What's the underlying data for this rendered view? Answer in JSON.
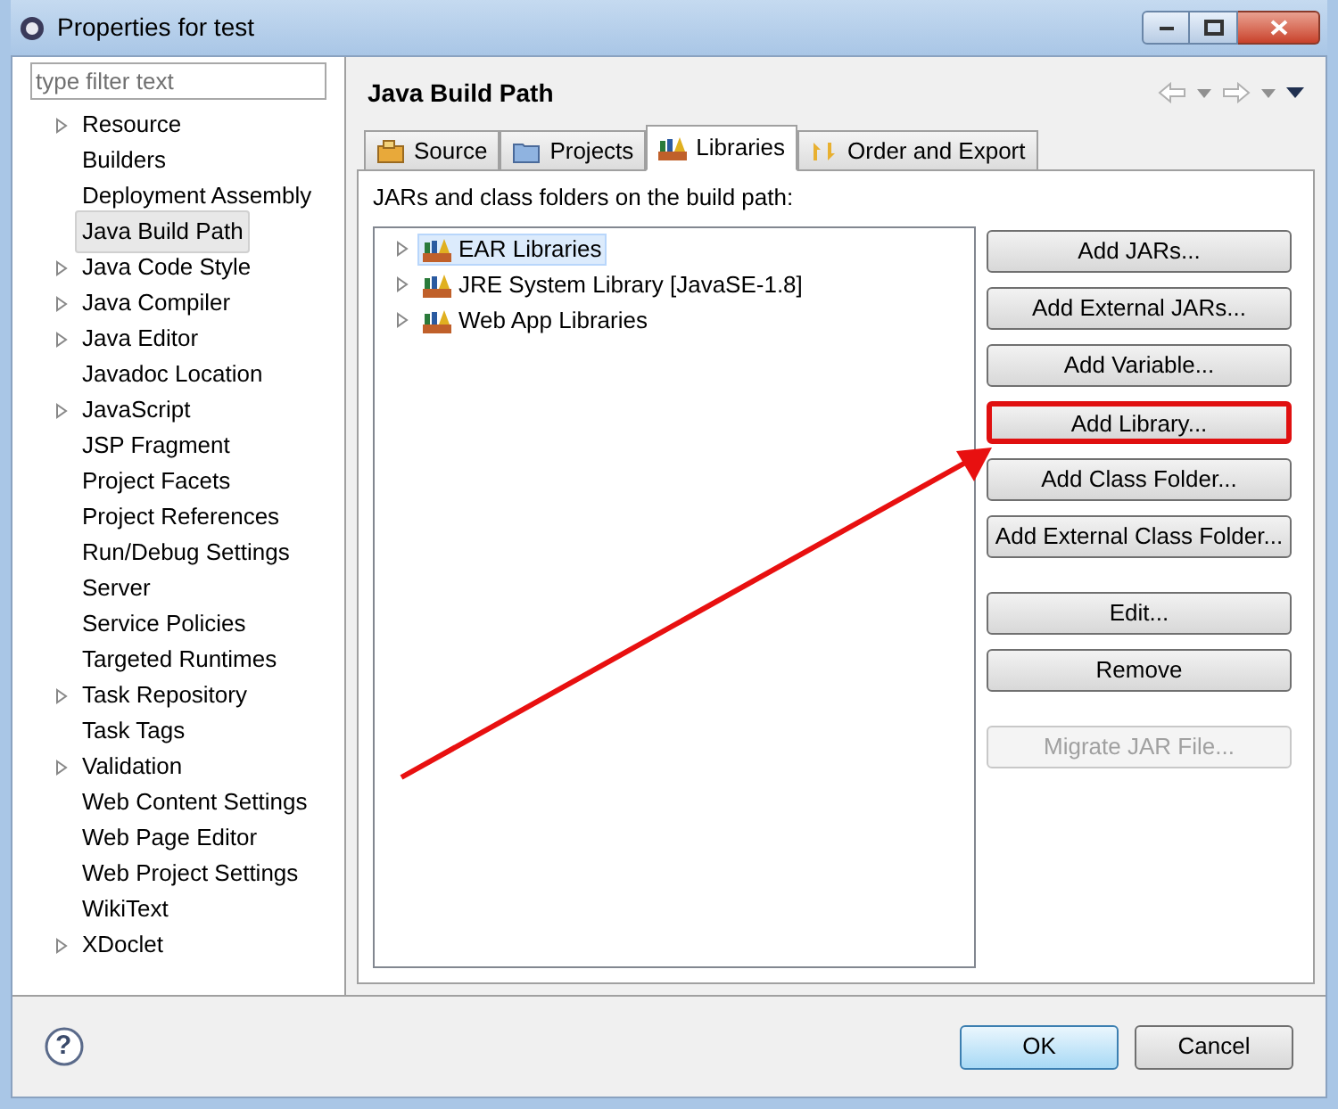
{
  "window": {
    "title": "Properties for test"
  },
  "filter": {
    "placeholder": "type filter text"
  },
  "nav": [
    {
      "label": "Resource",
      "expandable": true,
      "selected": false
    },
    {
      "label": "Builders",
      "expandable": false,
      "selected": false
    },
    {
      "label": "Deployment Assembly",
      "expandable": false,
      "selected": false
    },
    {
      "label": "Java Build Path",
      "expandable": false,
      "selected": true
    },
    {
      "label": "Java Code Style",
      "expandable": true,
      "selected": false
    },
    {
      "label": "Java Compiler",
      "expandable": true,
      "selected": false
    },
    {
      "label": "Java Editor",
      "expandable": true,
      "selected": false
    },
    {
      "label": "Javadoc Location",
      "expandable": false,
      "selected": false
    },
    {
      "label": "JavaScript",
      "expandable": true,
      "selected": false
    },
    {
      "label": "JSP Fragment",
      "expandable": false,
      "selected": false
    },
    {
      "label": "Project Facets",
      "expandable": false,
      "selected": false
    },
    {
      "label": "Project References",
      "expandable": false,
      "selected": false
    },
    {
      "label": "Run/Debug Settings",
      "expandable": false,
      "selected": false
    },
    {
      "label": "Server",
      "expandable": false,
      "selected": false
    },
    {
      "label": "Service Policies",
      "expandable": false,
      "selected": false
    },
    {
      "label": "Targeted Runtimes",
      "expandable": false,
      "selected": false
    },
    {
      "label": "Task Repository",
      "expandable": true,
      "selected": false
    },
    {
      "label": "Task Tags",
      "expandable": false,
      "selected": false
    },
    {
      "label": "Validation",
      "expandable": true,
      "selected": false
    },
    {
      "label": "Web Content Settings",
      "expandable": false,
      "selected": false
    },
    {
      "label": "Web Page Editor",
      "expandable": false,
      "selected": false
    },
    {
      "label": "Web Project Settings",
      "expandable": false,
      "selected": false
    },
    {
      "label": "WikiText",
      "expandable": false,
      "selected": false
    },
    {
      "label": "XDoclet",
      "expandable": true,
      "selected": false
    }
  ],
  "page": {
    "title": "Java Build Path"
  },
  "tabs": [
    {
      "label": "Source",
      "kind": "source",
      "selected": false
    },
    {
      "label": "Projects",
      "kind": "projects",
      "selected": false
    },
    {
      "label": "Libraries",
      "kind": "libraries",
      "selected": true
    },
    {
      "label": "Order and Export",
      "kind": "order",
      "selected": false
    }
  ],
  "list_caption": "JARs and class folders on the build path:",
  "libraries": [
    {
      "label": "EAR Libraries",
      "selected": true
    },
    {
      "label": "JRE System Library [JavaSE-1.8]",
      "selected": false
    },
    {
      "label": "Web App Libraries",
      "selected": false
    }
  ],
  "button_groups": [
    [
      {
        "label": "Add JARs...",
        "disabled": false,
        "highlighted": false
      },
      {
        "label": "Add External JARs...",
        "disabled": false,
        "highlighted": false
      },
      {
        "label": "Add Variable...",
        "disabled": false,
        "highlighted": false
      },
      {
        "label": "Add Library...",
        "disabled": false,
        "highlighted": true
      },
      {
        "label": "Add Class Folder...",
        "disabled": false,
        "highlighted": false
      },
      {
        "label": "Add External Class Folder...",
        "disabled": false,
        "highlighted": false
      }
    ],
    [
      {
        "label": "Edit...",
        "disabled": false,
        "highlighted": false
      },
      {
        "label": "Remove",
        "disabled": false,
        "highlighted": false
      }
    ],
    [
      {
        "label": "Migrate JAR File...",
        "disabled": true,
        "highlighted": false
      }
    ]
  ],
  "footer": {
    "help": "?",
    "ok": "OK",
    "cancel": "Cancel"
  }
}
